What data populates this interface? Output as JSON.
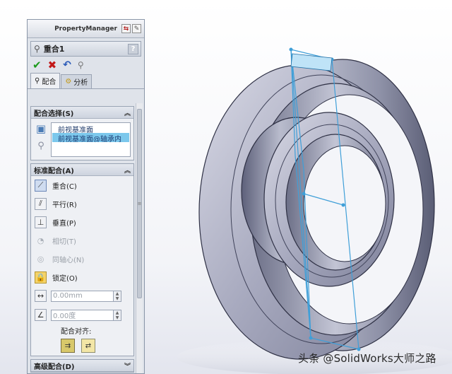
{
  "property_manager": {
    "title": "PropertyManager",
    "feature_name": "重合1",
    "help_label": "?",
    "tabs": [
      {
        "label": "配合",
        "active": true
      },
      {
        "label": "分析",
        "active": false
      }
    ]
  },
  "mate_selections": {
    "header": "配合选择(S)",
    "items": [
      "前视基准面",
      "前视基准面@轴承内"
    ]
  },
  "standard_mates": {
    "header": "标准配合(A)",
    "items": [
      {
        "label": "重合(C)",
        "icon": "coincident-icon",
        "state": "active"
      },
      {
        "label": "平行(R)",
        "icon": "parallel-icon",
        "state": "enabled"
      },
      {
        "label": "垂直(P)",
        "icon": "perpendicular-icon",
        "state": "enabled"
      },
      {
        "label": "相切(T)",
        "icon": "tangent-icon",
        "state": "disabled"
      },
      {
        "label": "同轴心(N)",
        "icon": "concentric-icon",
        "state": "disabled"
      },
      {
        "label": "锁定(O)",
        "icon": "lock-icon",
        "state": "enabled"
      }
    ],
    "distance_value": "0.00mm",
    "angle_value": "0.00度",
    "alignment_label": "配合对齐:"
  },
  "advanced_mates": {
    "header": "高级配合(D)"
  },
  "watermark": "头条 @SolidWorks大师之路",
  "colors": {
    "part_body": "#8d8fa6",
    "selection_plane": "#3f9fd8",
    "panel_bg": "#dfe3ea"
  }
}
